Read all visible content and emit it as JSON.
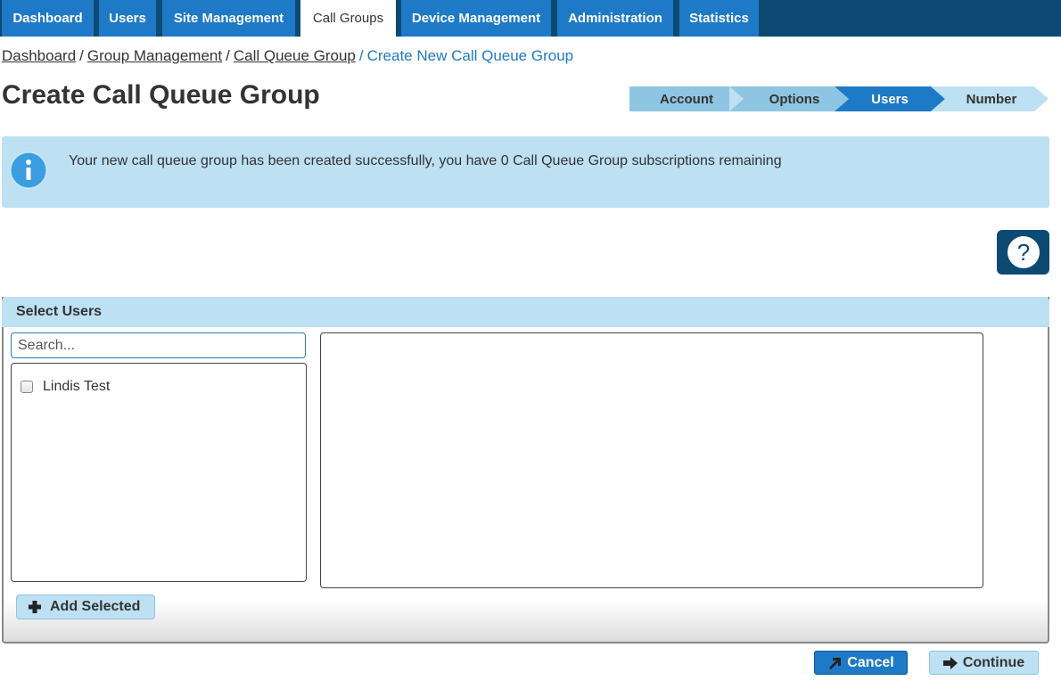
{
  "nav": {
    "tabs": [
      {
        "label": "Dashboard"
      },
      {
        "label": "Users"
      },
      {
        "label": "Site Management"
      },
      {
        "label": "Call Groups"
      },
      {
        "label": "Device Management"
      },
      {
        "label": "Administration"
      },
      {
        "label": "Statistics"
      }
    ],
    "active": "Call Groups"
  },
  "breadcrumb": {
    "items": [
      "Dashboard",
      "Group Management",
      "Call Queue Group"
    ],
    "current": "Create New Call Queue Group",
    "separator": "/"
  },
  "page_title": "Create Call Queue Group",
  "steps": [
    {
      "label": "Account",
      "state": "done"
    },
    {
      "label": "Options",
      "state": "done"
    },
    {
      "label": "Users",
      "state": "current"
    },
    {
      "label": "Number",
      "state": "pending"
    }
  ],
  "alert": {
    "message": "Your new call queue group has been created successfully, you have 0 Call Queue Group subscriptions remaining",
    "icon": "info-icon"
  },
  "help": {
    "icon": "question-icon"
  },
  "select_users": {
    "title": "Select Users",
    "search_placeholder": "Search...",
    "users": [
      {
        "name": "Lindis Test",
        "checked": false
      }
    ],
    "add_selected_label": "Add Selected"
  },
  "actions": {
    "cancel_label": "Cancel",
    "continue_label": "Continue"
  },
  "colors": {
    "nav_bg": "#0c4a73",
    "tab_bg": "#1e7ac6",
    "light_blue": "#bde0f2",
    "link_current": "#1e7ac6"
  }
}
